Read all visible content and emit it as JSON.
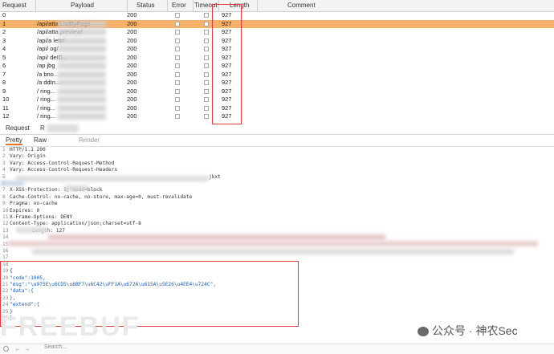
{
  "table": {
    "headers": {
      "request": "Request",
      "payload": "Payload",
      "status": "Status",
      "error": "Error",
      "timeout": "Timeout",
      "length": "Length",
      "comment": "Comment"
    },
    "rows": [
      {
        "id": "0",
        "payload": "",
        "status": "200",
        "length": "927"
      },
      {
        "id": "1",
        "payload": "/api/atta      ListByPage",
        "status": "200",
        "length": "927"
      },
      {
        "id": "2",
        "payload": "/api/atta        preview/",
        "status": "200",
        "length": "927"
      },
      {
        "id": "3",
        "payload": "/api/a               lete/",
        "status": "200",
        "length": "927"
      },
      {
        "id": "4",
        "payload": "/api/             og/",
        "status": "200",
        "length": "927"
      },
      {
        "id": "5",
        "payload": "/api/             deID...",
        "status": "200",
        "length": "927"
      },
      {
        "id": "6",
        "payload": "/ap              jbg",
        "status": "200",
        "length": "927"
      },
      {
        "id": "7",
        "payload": "/a            bno...",
        "status": "200",
        "length": "927"
      },
      {
        "id": "8",
        "payload": "/a            ddIn...",
        "status": "200",
        "length": "927"
      },
      {
        "id": "9",
        "payload": "/            ring...",
        "status": "200",
        "length": "927"
      },
      {
        "id": "10",
        "payload": "/            ring...",
        "status": "200",
        "length": "927"
      },
      {
        "id": "11",
        "payload": "/            ring...",
        "status": "200",
        "length": "927"
      },
      {
        "id": "12",
        "payload": "/            ring...",
        "status": "200",
        "length": "927"
      }
    ]
  },
  "tabs": {
    "request": "Request",
    "response": "R"
  },
  "subtabs": {
    "pretty": "Pretty",
    "raw": "Raw",
    "render": "Render"
  },
  "response": {
    "lines": [
      {
        "n": "1",
        "t": "HTTP/1.1 200"
      },
      {
        "n": "2",
        "t": "Vary: Origin"
      },
      {
        "n": "3",
        "t": "Vary: Access-Control-Request-Method"
      },
      {
        "n": "4",
        "t": "Vary: Access-Control-Request-Headers"
      },
      {
        "n": "5",
        "t": "jkxt"
      },
      {
        "n": "6",
        "t": ""
      },
      {
        "n": "7",
        "t": "X-XSS-Protection: 1; mode=block"
      },
      {
        "n": "8",
        "t": "Cache-Control: no-cache, no-store, max-age=0, must-revalidate"
      },
      {
        "n": "9",
        "t": "Pragma: no-cache"
      },
      {
        "n": "10",
        "t": "Expires: 0"
      },
      {
        "n": "11",
        "t": "X-Frame-Options: DENY"
      },
      {
        "n": "12",
        "t": "Content-Type: application/json;charset=utf-8"
      },
      {
        "n": "13",
        "t": "Length: 127"
      },
      {
        "n": "14",
        "t": ""
      },
      {
        "n": "15",
        "t": ""
      },
      {
        "n": "16",
        "t": ""
      },
      {
        "n": "17",
        "t": ""
      },
      {
        "n": "18",
        "t": ""
      },
      {
        "n": "19",
        "t": "{"
      },
      {
        "n": "20",
        "t": "  \"code\":1005,"
      },
      {
        "n": "21",
        "t": "  \"msg\":\"\\u975E\\u6CD5\\u8BF7\\u6C42\\uFF1A\\u672A\\u615A\\u5E26\\u4EE4\\u724C\","
      },
      {
        "n": "22",
        "t": "  \"data\":{"
      },
      {
        "n": "23",
        "t": "  },"
      },
      {
        "n": "24",
        "t": "  \"extend\":{"
      },
      {
        "n": "25",
        "t": "  }"
      },
      {
        "n": "26",
        "t": "}"
      }
    ]
  },
  "search": {
    "placeholder": "Search..."
  },
  "watermark": {
    "text": "公众号 · 神农Sec",
    "brand": "FREEBUF"
  },
  "colors": {
    "selected_row": "#f6b26b",
    "highlight_box": "#e23b3b"
  }
}
